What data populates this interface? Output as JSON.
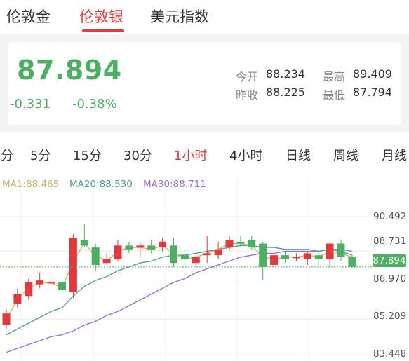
{
  "tabs": [
    {
      "label": "伦敦金",
      "active": false
    },
    {
      "label": "伦敦银",
      "active": true
    },
    {
      "label": "美元指数",
      "active": false
    }
  ],
  "quote": {
    "price": "87.894",
    "change": "-0.331",
    "change_pct": "-0.38%",
    "open_label": "今开",
    "open": "88.234",
    "high_label": "最高",
    "high": "89.409",
    "prev_close_label": "昨收",
    "prev_close": "88.225",
    "low_label": "最低",
    "low": "87.794"
  },
  "periods": [
    {
      "label": "分",
      "active": false
    },
    {
      "label": "5分",
      "active": false
    },
    {
      "label": "15分",
      "active": false
    },
    {
      "label": "30分",
      "active": false
    },
    {
      "label": "1小时",
      "active": true
    },
    {
      "label": "4小时",
      "active": false
    },
    {
      "label": "日线",
      "active": false
    },
    {
      "label": "周线",
      "active": false
    },
    {
      "label": "月线",
      "active": false
    }
  ],
  "ma": {
    "ma1": "MA1:88.465",
    "ma20": "MA20:88.530",
    "ma30": "MA30:88.711"
  },
  "colors": {
    "up": "#e0393e",
    "down": "#4caf62",
    "ma1": "#c9b26a",
    "ma20": "#4f9f95",
    "ma30": "#9c6ed6"
  },
  "chart_data": {
    "type": "candlestick",
    "y_ticks": [
      "90.492",
      "88.731",
      "86.970",
      "85.209",
      "83.448"
    ],
    "ylim": [
      83.448,
      90.492
    ],
    "current_price": "87.894",
    "candles": [
      {
        "o": 84.9,
        "c": 85.5,
        "h": 85.7,
        "l": 84.7
      },
      {
        "o": 86.0,
        "c": 86.5,
        "h": 86.8,
        "l": 85.8
      },
      {
        "o": 86.4,
        "c": 87.1,
        "h": 87.3,
        "l": 86.2
      },
      {
        "o": 87.0,
        "c": 87.2,
        "h": 87.6,
        "l": 86.8
      },
      {
        "o": 87.1,
        "c": 87.1,
        "h": 87.3,
        "l": 86.9
      },
      {
        "o": 87.1,
        "c": 86.7,
        "h": 87.3,
        "l": 86.5
      },
      {
        "o": 86.6,
        "c": 89.4,
        "h": 89.6,
        "l": 86.3
      },
      {
        "o": 89.3,
        "c": 89.0,
        "h": 90.1,
        "l": 88.9
      },
      {
        "o": 88.9,
        "c": 88.0,
        "h": 89.1,
        "l": 87.7
      },
      {
        "o": 88.1,
        "c": 88.3,
        "h": 88.6,
        "l": 88.0
      },
      {
        "o": 88.3,
        "c": 89.0,
        "h": 89.3,
        "l": 88.2
      },
      {
        "o": 89.0,
        "c": 88.8,
        "h": 89.2,
        "l": 88.6
      },
      {
        "o": 88.9,
        "c": 89.0,
        "h": 89.2,
        "l": 88.4
      },
      {
        "o": 89.0,
        "c": 88.8,
        "h": 89.3,
        "l": 88.6
      },
      {
        "o": 88.9,
        "c": 89.2,
        "h": 89.4,
        "l": 88.7
      },
      {
        "o": 89.0,
        "c": 88.1,
        "h": 89.4,
        "l": 87.9
      },
      {
        "o": 88.5,
        "c": 88.3,
        "h": 88.8,
        "l": 88.0
      },
      {
        "o": 88.1,
        "c": 88.4,
        "h": 88.6,
        "l": 87.9
      },
      {
        "o": 88.5,
        "c": 88.6,
        "h": 89.5,
        "l": 88.1
      },
      {
        "o": 88.5,
        "c": 88.8,
        "h": 89.2,
        "l": 88.3
      },
      {
        "o": 88.9,
        "c": 89.3,
        "h": 89.5,
        "l": 88.8
      },
      {
        "o": 89.2,
        "c": 89.1,
        "h": 89.5,
        "l": 88.9
      },
      {
        "o": 89.3,
        "c": 88.9,
        "h": 89.5,
        "l": 88.8
      },
      {
        "o": 89.1,
        "c": 87.9,
        "h": 89.2,
        "l": 87.2
      },
      {
        "o": 88.0,
        "c": 88.5,
        "h": 88.6,
        "l": 87.9
      },
      {
        "o": 88.5,
        "c": 88.3,
        "h": 88.7,
        "l": 88.1
      },
      {
        "o": 88.4,
        "c": 88.4,
        "h": 88.6,
        "l": 88.2
      },
      {
        "o": 88.3,
        "c": 88.6,
        "h": 88.7,
        "l": 88.0
      },
      {
        "o": 88.5,
        "c": 88.3,
        "h": 88.7,
        "l": 88.0
      },
      {
        "o": 88.3,
        "c": 89.1,
        "h": 89.2,
        "l": 87.9
      },
      {
        "o": 89.1,
        "c": 88.4,
        "h": 89.3,
        "l": 88.2
      },
      {
        "o": 88.4,
        "c": 87.9,
        "h": 88.5,
        "l": 87.8
      }
    ],
    "ma1": [
      85.2,
      86.2,
      86.8,
      87.1,
      87.1,
      86.8,
      88.2,
      89.1,
      88.5,
      88.2,
      88.7,
      88.9,
      88.9,
      88.8,
      89.0,
      88.6,
      88.3,
      88.4,
      88.6,
      88.8,
      89.1,
      89.1,
      89.0,
      88.4,
      88.3,
      88.4,
      88.4,
      88.5,
      88.4,
      88.7,
      88.6,
      88.4
    ],
    "ma20": [
      84.4,
      84.7,
      85.0,
      85.3,
      85.6,
      85.8,
      86.4,
      86.9,
      87.2,
      87.4,
      87.7,
      87.9,
      88.1,
      88.2,
      88.4,
      88.5,
      88.5,
      88.6,
      88.7,
      88.8,
      88.9,
      89.0,
      89.0,
      88.9,
      88.9,
      88.8,
      88.8,
      88.8,
      88.7,
      88.8,
      88.7,
      88.5
    ],
    "ma30": [
      83.5,
      83.7,
      83.9,
      84.1,
      84.3,
      84.4,
      84.6,
      84.9,
      85.1,
      85.4,
      85.6,
      85.9,
      86.2,
      86.5,
      86.8,
      87.1,
      87.3,
      87.6,
      87.8,
      88.0,
      88.2,
      88.4,
      88.5,
      88.6,
      88.6,
      88.7,
      88.7,
      88.7,
      88.7,
      88.8,
      88.8,
      88.7
    ]
  }
}
